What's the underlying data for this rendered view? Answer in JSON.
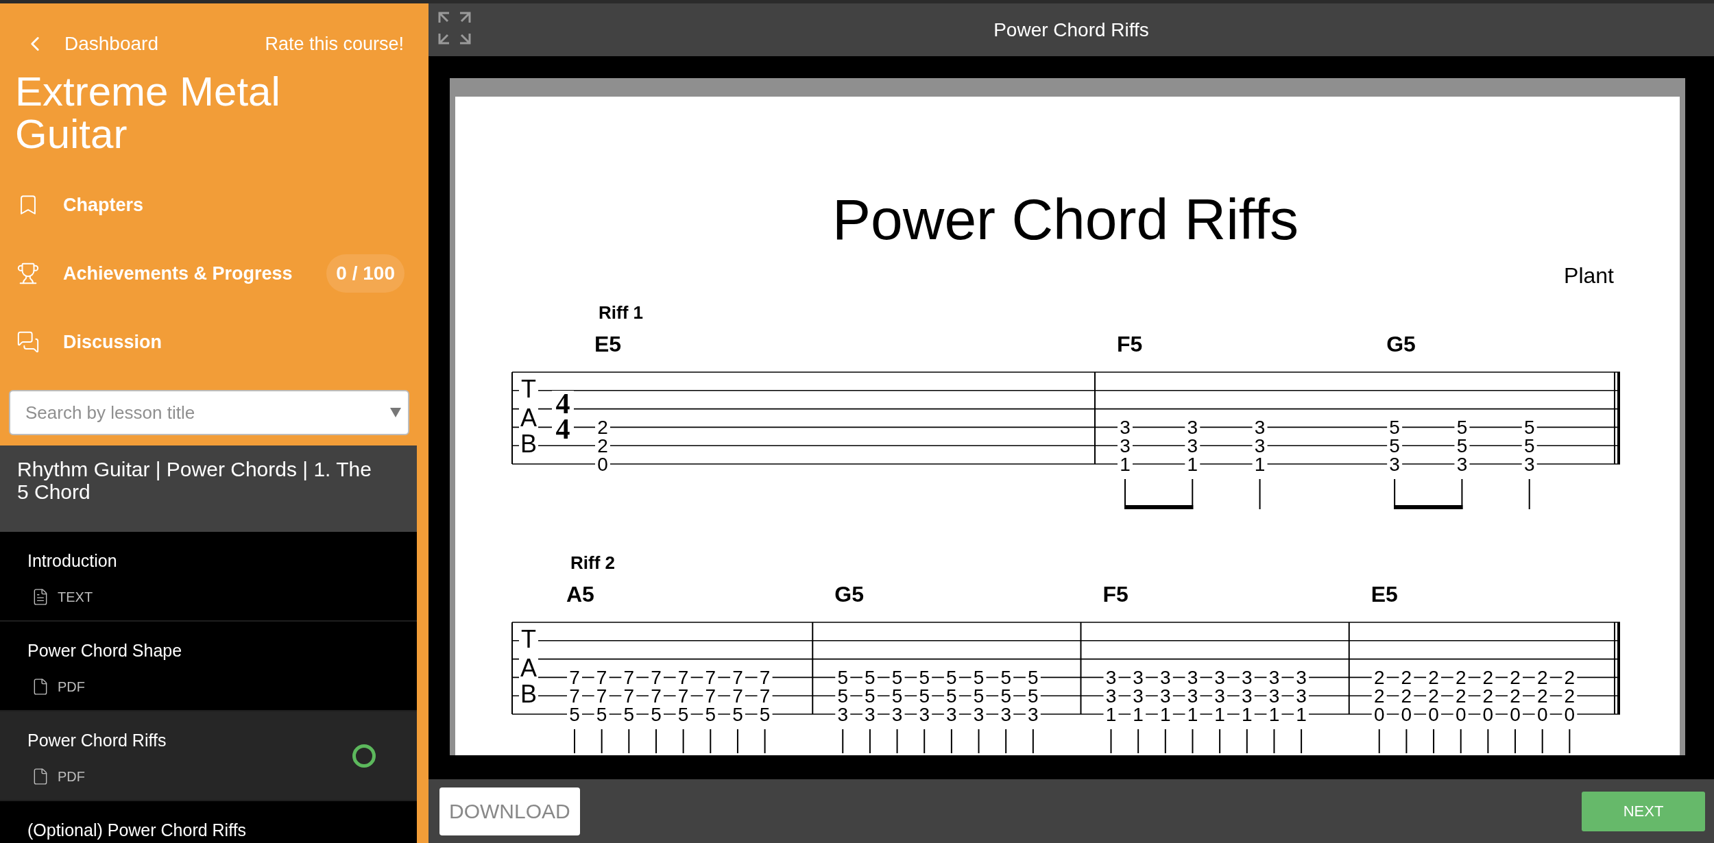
{
  "sidebar": {
    "back_link": "Dashboard",
    "rate_link": "Rate this course!",
    "course_title": "Extreme Metal Guitar",
    "nav": [
      {
        "label": "Chapters",
        "kind": "chapters"
      },
      {
        "label": "Achievements & Progress",
        "kind": "achievements",
        "badge": "0 / 100"
      },
      {
        "label": "Discussion",
        "kind": "discussion"
      }
    ],
    "search": {
      "placeholder": "Search by lesson title"
    },
    "chapter_title": "Rhythm Guitar | Power Chords | 1. The 5 Chord",
    "lessons": [
      {
        "title": "Introduction",
        "type": "TEXT",
        "kind": "text",
        "selected": false,
        "progress_ring": false
      },
      {
        "title": "Power Chord Shape",
        "type": "PDF",
        "kind": "pdf",
        "selected": false,
        "progress_ring": false
      },
      {
        "title": "Power Chord Riffs",
        "type": "PDF",
        "kind": "pdf",
        "selected": true,
        "progress_ring": true
      },
      {
        "title": "(Optional) Power Chord Riffs",
        "selected": false,
        "progress_ring": false
      }
    ]
  },
  "viewer": {
    "title": "Power Chord Riffs",
    "document": {
      "title": "Power Chord Riffs",
      "composer": "Plant",
      "systems": [
        {
          "label": "Riff 1",
          "clef": [
            "T",
            "A",
            "B"
          ],
          "time_signature": [
            "4",
            "4"
          ],
          "measures": [
            {
              "groups": [
                {
                  "chord": "E5",
                  "columns": [
                    {
                      "kind": "whole",
                      "frets": [
                        "2",
                        "2",
                        "0"
                      ]
                    }
                  ]
                }
              ]
            },
            {
              "groups": [
                {
                  "chord": "F5",
                  "columns": [
                    {
                      "kind": "beam-start",
                      "frets": [
                        "3",
                        "3",
                        "1"
                      ]
                    },
                    {
                      "kind": "beam-end",
                      "frets": [
                        "3",
                        "3",
                        "1"
                      ]
                    },
                    {
                      "kind": "single",
                      "frets": [
                        "3",
                        "3",
                        "1"
                      ]
                    }
                  ]
                },
                {
                  "chord": "G5",
                  "columns": [
                    {
                      "kind": "beam-start",
                      "frets": [
                        "5",
                        "5",
                        "3"
                      ]
                    },
                    {
                      "kind": "beam-end",
                      "frets": [
                        "5",
                        "5",
                        "3"
                      ]
                    },
                    {
                      "kind": "single",
                      "frets": [
                        "5",
                        "5",
                        "3"
                      ]
                    }
                  ]
                }
              ]
            }
          ]
        },
        {
          "label": "Riff 2",
          "clef": [
            "T",
            "A",
            "B"
          ],
          "measures": [
            {
              "groups": [
                {
                  "chord": "A5",
                  "columns": [
                    {
                      "kind": "single",
                      "frets": [
                        "7",
                        "7",
                        "5"
                      ]
                    },
                    {
                      "kind": "single",
                      "frets": [
                        "7",
                        "7",
                        "5"
                      ]
                    },
                    {
                      "kind": "single",
                      "frets": [
                        "7",
                        "7",
                        "5"
                      ]
                    },
                    {
                      "kind": "single",
                      "frets": [
                        "7",
                        "7",
                        "5"
                      ]
                    },
                    {
                      "kind": "single",
                      "frets": [
                        "7",
                        "7",
                        "5"
                      ]
                    },
                    {
                      "kind": "single",
                      "frets": [
                        "7",
                        "7",
                        "5"
                      ]
                    },
                    {
                      "kind": "single",
                      "frets": [
                        "7",
                        "7",
                        "5"
                      ]
                    },
                    {
                      "kind": "single",
                      "frets": [
                        "7",
                        "7",
                        "5"
                      ]
                    }
                  ]
                }
              ]
            },
            {
              "groups": [
                {
                  "chord": "G5",
                  "columns": [
                    {
                      "kind": "single",
                      "frets": [
                        "5",
                        "5",
                        "3"
                      ]
                    },
                    {
                      "kind": "single",
                      "frets": [
                        "5",
                        "5",
                        "3"
                      ]
                    },
                    {
                      "kind": "single",
                      "frets": [
                        "5",
                        "5",
                        "3"
                      ]
                    },
                    {
                      "kind": "single",
                      "frets": [
                        "5",
                        "5",
                        "3"
                      ]
                    },
                    {
                      "kind": "single",
                      "frets": [
                        "5",
                        "5",
                        "3"
                      ]
                    },
                    {
                      "kind": "single",
                      "frets": [
                        "5",
                        "5",
                        "3"
                      ]
                    },
                    {
                      "kind": "single",
                      "frets": [
                        "5",
                        "5",
                        "3"
                      ]
                    },
                    {
                      "kind": "single",
                      "frets": [
                        "5",
                        "5",
                        "3"
                      ]
                    }
                  ]
                }
              ]
            },
            {
              "groups": [
                {
                  "chord": "F5",
                  "columns": [
                    {
                      "kind": "single",
                      "frets": [
                        "3",
                        "3",
                        "1"
                      ]
                    },
                    {
                      "kind": "single",
                      "frets": [
                        "3",
                        "3",
                        "1"
                      ]
                    },
                    {
                      "kind": "single",
                      "frets": [
                        "3",
                        "3",
                        "1"
                      ]
                    },
                    {
                      "kind": "single",
                      "frets": [
                        "3",
                        "3",
                        "1"
                      ]
                    },
                    {
                      "kind": "single",
                      "frets": [
                        "3",
                        "3",
                        "1"
                      ]
                    },
                    {
                      "kind": "single",
                      "frets": [
                        "3",
                        "3",
                        "1"
                      ]
                    },
                    {
                      "kind": "single",
                      "frets": [
                        "3",
                        "3",
                        "1"
                      ]
                    },
                    {
                      "kind": "single",
                      "frets": [
                        "3",
                        "3",
                        "1"
                      ]
                    }
                  ]
                }
              ]
            },
            {
              "groups": [
                {
                  "chord": "E5",
                  "columns": [
                    {
                      "kind": "single",
                      "frets": [
                        "2",
                        "2",
                        "0"
                      ]
                    },
                    {
                      "kind": "single",
                      "frets": [
                        "2",
                        "2",
                        "0"
                      ]
                    },
                    {
                      "kind": "single",
                      "frets": [
                        "2",
                        "2",
                        "0"
                      ]
                    },
                    {
                      "kind": "single",
                      "frets": [
                        "2",
                        "2",
                        "0"
                      ]
                    },
                    {
                      "kind": "single",
                      "frets": [
                        "2",
                        "2",
                        "0"
                      ]
                    },
                    {
                      "kind": "single",
                      "frets": [
                        "2",
                        "2",
                        "0"
                      ]
                    },
                    {
                      "kind": "single",
                      "frets": [
                        "2",
                        "2",
                        "0"
                      ]
                    },
                    {
                      "kind": "single",
                      "frets": [
                        "2",
                        "2",
                        "0"
                      ]
                    }
                  ]
                }
              ]
            }
          ]
        }
      ]
    }
  },
  "footer": {
    "download": "DOWNLOAD",
    "next": "NEXT"
  }
}
